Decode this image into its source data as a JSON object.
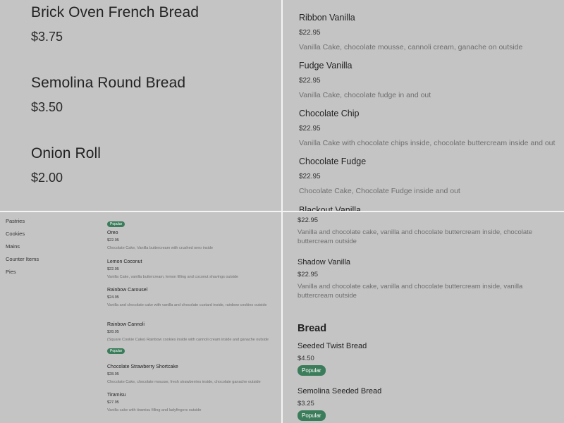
{
  "top_left": {
    "items": [
      {
        "name": "Brick Oven French Bread",
        "price": "$3.75"
      },
      {
        "name": "Semolina Round Bread",
        "price": "$3.50"
      },
      {
        "name": "Onion Roll",
        "price": "$2.00"
      }
    ]
  },
  "top_right": {
    "items": [
      {
        "name": "Ribbon Vanilla",
        "price": "$22.95",
        "description": "Vanilla Cake, chocolate mousse, cannoli cream, ganache on outside"
      },
      {
        "name": "Fudge Vanilla",
        "price": "$22.95",
        "description": "Vanilla Cake, chocolate fudge in and out"
      },
      {
        "name": "Chocolate Chip",
        "price": "$22.95",
        "description": "Vanilla Cake with chocolate chips inside, chocolate buttercream inside and out"
      },
      {
        "name": "Chocolate Fudge",
        "price": "$22.95",
        "description": "Chocolate Cake, Chocolate Fudge inside and out"
      },
      {
        "name": "Blackout Vanilla"
      }
    ]
  },
  "bottom_left": {
    "sidebar": [
      "Pastries",
      "Cookies",
      "Mains",
      "Counter Items",
      "Pies"
    ],
    "popular_label": "Popular",
    "items": [
      {
        "name": "Oreo",
        "price": "$22.95",
        "description": "Chocolate Cake, Vanilla buttercream with crushed oreo inside"
      },
      {
        "name": "Lemon Coconut",
        "price": "$22.95",
        "description": "Vanilla Cake, vanilla buttercream, lemon filling and coconut shavings outside"
      },
      {
        "name": "Rainbow Carousel",
        "price": "$24.95",
        "description": "Vanilla and chocolate cake with vanilla and chocolate custard inside, rainbow cookies outside"
      },
      {
        "name": "Rainbow Cannoli",
        "price": "$28.95",
        "description": "(Square Cookie Cake) Rainbow cookies inside with cannoli cream inside and ganache outside"
      },
      {
        "name": "Chocolate Strawberry Shortcake",
        "price": "$28.95",
        "description": "Chocolate Cake, chocolate mousse, fresh strawberries inside, chocolate ganache outside"
      },
      {
        "name": "Tiramisu",
        "price": "$27.95",
        "description": "Vanilla cake with tiramisu filling and ladyfingers outside"
      }
    ]
  },
  "bottom_right": {
    "items": [
      {
        "price": "$22.95",
        "description": "Vanilla and chocolate cake, vanilla and chocolate buttercream inside, chocolate buttercream outside"
      },
      {
        "name": "Shadow Vanilla",
        "price": "$22.95",
        "description": "Vanilla and chocolate cake, vanilla and chocolate buttercream inside, vanilla buttercream outside"
      }
    ],
    "section_title": "Bread",
    "bread_items": [
      {
        "name": "Seeded Twist Bread",
        "price": "$4.50",
        "badge": "Popular"
      },
      {
        "name": "Semolina Seeded Bread",
        "price": "$3.25",
        "badge": "Popular"
      }
    ]
  },
  "colors": {
    "background": "#c4c4c4",
    "divider": "#f4f4f4",
    "popular_badge": "#3b7c5a"
  }
}
